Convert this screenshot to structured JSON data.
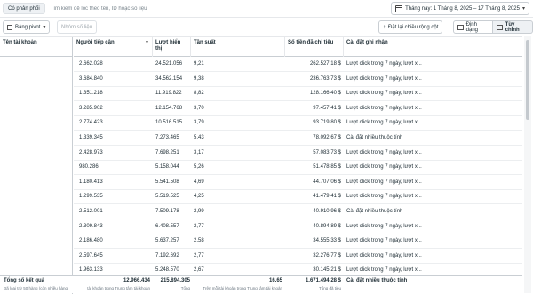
{
  "topbar": {
    "chip_label": "Có phản phối",
    "search_placeholder": "Tìm kiếm để lọc theo tên, ID hoặc số liệu",
    "date_range": "Tháng này: 1 Tháng 8, 2025 – 17 Tháng 8, 2025"
  },
  "toolbar": {
    "pivot_label": "Bảng pivot",
    "group_label": "Nhóm số liệu",
    "reset_cols_label": "Đặt lại chiều rộng cột",
    "format_label": "Định dạng",
    "custom_label": "Tùy chỉnh"
  },
  "columns": {
    "account": "Tên tài khoản",
    "reach": "Người tiếp cận",
    "impressions": "Lượt hiển thị",
    "frequency": "Tần suất",
    "spend": "Số tiền đã chi tiêu",
    "attribution": "Cài đặt ghi nhận"
  },
  "rows": [
    {
      "reach": "2.662.028",
      "impressions": "24.521.056",
      "frequency": "9,21",
      "spend": "262.527,18 $",
      "attribution": "Lượt click trong 7 ngày, lượt x..."
    },
    {
      "reach": "3.684.840",
      "impressions": "34.562.154",
      "frequency": "9,38",
      "spend": "236.763,73 $",
      "attribution": "Lượt click trong 7 ngày, lượt x..."
    },
    {
      "reach": "1.351.218",
      "impressions": "11.919.822",
      "frequency": "8,82",
      "spend": "128.166,40 $",
      "attribution": "Lượt click trong 7 ngày, lượt x..."
    },
    {
      "reach": "3.285.902",
      "impressions": "12.154.768",
      "frequency": "3,70",
      "spend": "97.457,41 $",
      "attribution": "Lượt click trong 7 ngày, lượt x..."
    },
    {
      "reach": "2.774.423",
      "impressions": "10.516.515",
      "frequency": "3,79",
      "spend": "93.719,80 $",
      "attribution": "Lượt click trong 7 ngày, lượt x..."
    },
    {
      "reach": "1.339.345",
      "impressions": "7.273.465",
      "frequency": "5,43",
      "spend": "78.092,67 $",
      "attribution": "Cài đặt nhiều thuộc tính"
    },
    {
      "reach": "2.428.973",
      "impressions": "7.698.251",
      "frequency": "3,17",
      "spend": "57.083,73 $",
      "attribution": "Lượt click trong 7 ngày, lượt x..."
    },
    {
      "reach": "980.286",
      "impressions": "5.158.044",
      "frequency": "5,26",
      "spend": "51.478,85 $",
      "attribution": "Lượt click trong 7 ngày, lượt x..."
    },
    {
      "reach": "1.180.413",
      "impressions": "5.541.508",
      "frequency": "4,69",
      "spend": "44.707,06 $",
      "attribution": "Lượt click trong 7 ngày, lượt x..."
    },
    {
      "reach": "1.299.535",
      "impressions": "5.519.525",
      "frequency": "4,25",
      "spend": "41.479,41 $",
      "attribution": "Lượt click trong 7 ngày, lượt x..."
    },
    {
      "reach": "2.512.001",
      "impressions": "7.509.178",
      "frequency": "2,99",
      "spend": "40.910,96 $",
      "attribution": "Cài đặt nhiều thuộc tính"
    },
    {
      "reach": "2.309.843",
      "impressions": "6.408.557",
      "frequency": "2,77",
      "spend": "40.894,89 $",
      "attribution": "Lượt click trong 7 ngày, lượt x..."
    },
    {
      "reach": "2.186.480",
      "impressions": "5.637.257",
      "frequency": "2,58",
      "spend": "34.555,33 $",
      "attribution": "Lượt click trong 7 ngày, lượt x..."
    },
    {
      "reach": "2.597.645",
      "impressions": "7.192.692",
      "frequency": "2,77",
      "spend": "32.276,77 $",
      "attribution": "Lượt click trong 7 ngày, lượt x..."
    },
    {
      "reach": "1.963.133",
      "impressions": "5.248.570",
      "frequency": "2,67",
      "spend": "30.145,21 $",
      "attribution": "Lượt click trong 7 ngày, lượt x..."
    }
  ],
  "footer": {
    "title": "Tổng số kết quả",
    "subtitle": "Đã loại trừ 50 hàng (còn nhiều hàng",
    "reach": "12.966.434",
    "reach_sub": "tài khoản trong Trung tâm tài khoản",
    "impressions": "215.894.305",
    "impressions_sub": "Tổng",
    "frequency": "16,65",
    "frequency_sub": "Trên mỗi tài khoản trong Trung tâm tài khoản",
    "spend": "1.671.494,28 $",
    "spend_sub": "Tổng đã tiêu",
    "attribution": "Cài đặt nhiều thuộc tính"
  }
}
